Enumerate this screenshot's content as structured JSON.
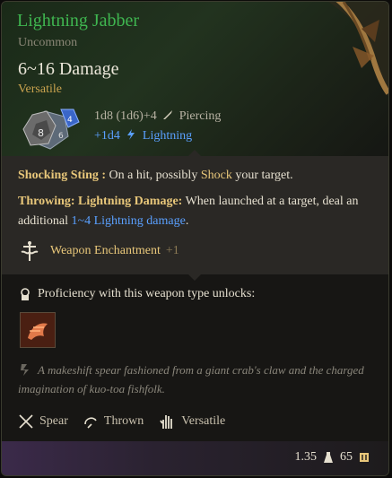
{
  "item": {
    "name": "Lightning Jabber",
    "rarity": "Uncommon",
    "damage": "6~16 Damage",
    "property": "Versatile"
  },
  "dice": {
    "front": "8",
    "back": "6",
    "small": "4"
  },
  "damage_lines": {
    "base": "1d8 (1d6)+4",
    "base_type": "Piercing",
    "bonus": "+1d4",
    "bonus_type": "Lightning"
  },
  "abilities": {
    "shocking_name": "Shocking Sting :",
    "shocking_pre": " On a hit, possibly ",
    "shocking_link": "Shock",
    "shocking_post": " your target.",
    "throwing_name": "Throwing: Lightning Damage:",
    "throwing_pre": " When launched at a target, deal an additional ",
    "throwing_link": "1~4 Lightning damage",
    "throwing_post": "."
  },
  "enchantment": {
    "label": "Weapon Enchantment",
    "value": "+1"
  },
  "proficiency": {
    "label": "Proficiency with this weapon type unlocks:"
  },
  "flavor": "A makeshift spear fashioned from a giant crab's claw and the charged imagination of kuo-toa fishfolk.",
  "properties": [
    {
      "label": "Spear",
      "icon": "spear-icon"
    },
    {
      "label": "Thrown",
      "icon": "thrown-icon"
    },
    {
      "label": "Versatile",
      "icon": "versatile-hand-icon"
    }
  ],
  "footer": {
    "weight": "1.35",
    "value": "65"
  },
  "colors": {
    "name": "#3fb650",
    "accent_gold": "#e8c77a",
    "lightning_blue": "#5aa0ff"
  }
}
